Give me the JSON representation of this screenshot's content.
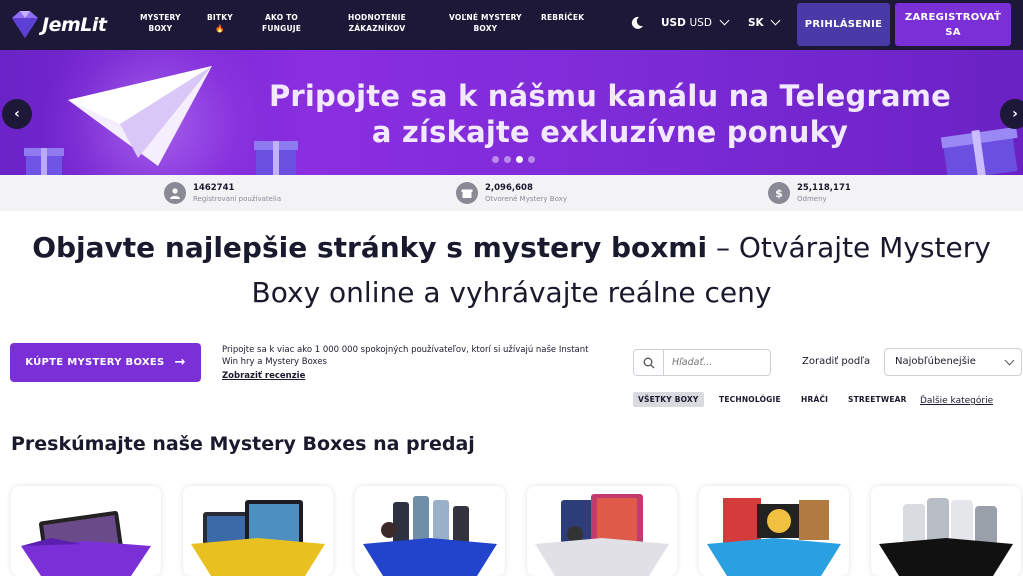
{
  "nav": {
    "logo_text": "JemLit",
    "items": [
      {
        "line1": "MYSTERY",
        "line2": "BOXY"
      },
      {
        "line1": "BITKY",
        "line2": "🔥"
      },
      {
        "line1": "AKO TO",
        "line2": "FUNGUJE"
      },
      {
        "line1": "HODNOTENIE",
        "line2": "ZÁKAZNÍKOV"
      },
      {
        "line1": "VOĽNÉ MYSTERY",
        "line2": "BOXY"
      },
      {
        "line1": "REBRÍČEK",
        "line2": ""
      }
    ],
    "currency_bold": "USD",
    "currency_thin": "USD",
    "language": "SK",
    "login_label": "PRIHLÁSENIE",
    "register_label": "ZAREGISTROVAŤ SA"
  },
  "banner": {
    "line1": "Pripojte sa k nášmu kanálu na Telegrame",
    "line2": "a získajte exkluzívne ponuky",
    "prev": "‹",
    "next": "›",
    "slide_count": 4,
    "active_slide": 3
  },
  "stats": [
    {
      "icon": "user-icon",
      "number": "1462741",
      "label": "Registrovaní používatelia"
    },
    {
      "icon": "box-icon",
      "number": "2,096,608",
      "label": "Otvorené Mystery Boxy"
    },
    {
      "icon": "dollar-icon",
      "number": "25,118,171",
      "label": "Odmeny"
    }
  ],
  "headline": {
    "bold": "Objavte najlepšie stránky s mystery boxmi",
    "rest_line1": " – Otvárajte Mystery",
    "line2": "Boxy online a vyhrávajte reálne ceny"
  },
  "cta": {
    "button_label": "KÚPTE MYSTERY BOXES",
    "description": "Pripojte sa k viac ako 1 000 000 spokojných používateľov, ktorí si užívajú naše Instant Win hry a Mystery Boxes",
    "reviews_link": "Zobraziť recenzie"
  },
  "search": {
    "placeholder": "Hľadať..."
  },
  "sort": {
    "label": "Zoradiť podľa",
    "selected": "Najobľúbenejšie"
  },
  "categories": [
    "VŠETKY BOXY",
    "TECHNOLÓGIE",
    "HRÁČI",
    "STREETWEAR"
  ],
  "more_categories": "Ďalšie kategórie",
  "section_title": "Preskúmajte naše Mystery Boxes na predaj",
  "colors": {
    "nav_bg": "#1d1838",
    "accent": "#7b2fd6",
    "login_bg": "#4a3aa8",
    "banner": "#7e2bd8"
  },
  "cards": [
    {
      "box_color": "#7b2fd6"
    },
    {
      "box_color": "#e8c020"
    },
    {
      "box_color": "#2244cc"
    },
    {
      "box_color": "#e0e0e6"
    },
    {
      "box_color": "#2ba0e0"
    },
    {
      "box_color": "#111111"
    }
  ]
}
